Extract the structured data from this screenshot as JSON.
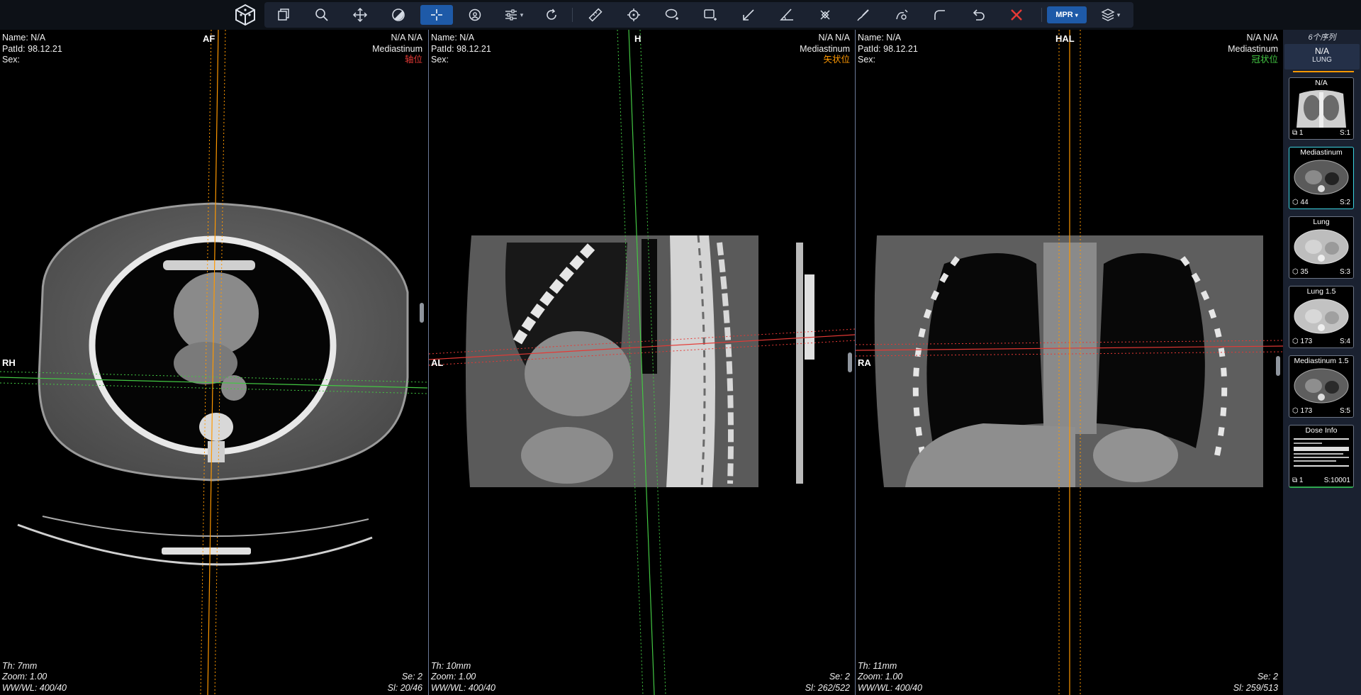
{
  "colors": {
    "toolbar_bg": "#0d1117",
    "accent": "#1e5aa8",
    "crosshair_red": "#e53935",
    "crosshair_orange": "#ff9800",
    "crosshair_green": "#43c743"
  },
  "toolbar": {
    "tools": [
      {
        "icon": "copy-layers-icon"
      },
      {
        "icon": "zoom-magnifier-icon"
      },
      {
        "icon": "pan-move-icon"
      },
      {
        "icon": "window-level-contrast-icon"
      },
      {
        "icon": "crosshair-icon",
        "active": true
      },
      {
        "icon": "rotate-3d-icon"
      },
      {
        "icon": "sliders-adjust-icon",
        "dropdown": true
      },
      {
        "icon": "refresh-rotate-icon"
      },
      {
        "icon": "ruler-icon"
      },
      {
        "icon": "target-point-icon"
      },
      {
        "icon": "ellipse-roi-icon"
      },
      {
        "icon": "rectangle-roi-icon"
      },
      {
        "icon": "arrow-annotate-icon"
      },
      {
        "icon": "angle-icon"
      },
      {
        "icon": "eraser-icon"
      },
      {
        "icon": "freehand-pen-icon"
      },
      {
        "icon": "spline-pen-icon"
      },
      {
        "icon": "curve-icon"
      },
      {
        "icon": "undo-icon"
      },
      {
        "icon": "clear-x-icon"
      }
    ],
    "mpr_label": "MPR",
    "layers_icon": "layers-icon"
  },
  "viewports": [
    {
      "top_left": [
        "Name: N/A",
        "PatId: 98.12.21",
        "Sex:"
      ],
      "top_right": [
        "N/A N/A",
        "Mediastinum"
      ],
      "plane_label": "轴位",
      "plane_color": "red",
      "top_orient": "AF",
      "left_orient": "RH",
      "bottom_left": [
        "Th: 7mm",
        "Zoom: 1.00",
        "WW/WL: 400/40"
      ],
      "bottom_right": [
        "Se: 2",
        "Sl: 20/46"
      ]
    },
    {
      "top_left": [
        "Name: N/A",
        "PatId: 98.12.21",
        "Sex:"
      ],
      "top_right": [
        "N/A N/A",
        "Mediastinum"
      ],
      "plane_label": "矢状位",
      "plane_color": "orange",
      "top_orient": "H",
      "left_orient": "AL",
      "bottom_left": [
        "Th: 10mm",
        "Zoom: 1.00",
        "WW/WL: 400/40"
      ],
      "bottom_right": [
        "Se: 2",
        "Sl: 262/522"
      ]
    },
    {
      "top_left": [
        "Name: N/A",
        "PatId: 98.12.21",
        "Sex:"
      ],
      "top_right": [
        "N/A N/A",
        "Mediastinum"
      ],
      "plane_label": "冠状位",
      "plane_color": "green",
      "top_orient": "HAL",
      "left_orient": "RA",
      "bottom_left": [
        "Th: 11mm",
        "Zoom: 1.00",
        "WW/WL: 400/40"
      ],
      "bottom_right": [
        "Se: 2",
        "Sl: 259/513"
      ]
    }
  ],
  "series_panel": {
    "count_label": "6个序列",
    "header_name": "N/A",
    "header_sub": "LUNG",
    "thumbnails": [
      {
        "name": "N/A",
        "count": "1",
        "series": "S:1",
        "kind": "scout"
      },
      {
        "name": "Mediastinum",
        "count": "44",
        "series": "S:2",
        "kind": "axial-soft",
        "selected": true
      },
      {
        "name": "Lung",
        "count": "35",
        "series": "S:3",
        "kind": "axial-lung"
      },
      {
        "name": "Lung 1.5",
        "count": "173",
        "series": "S:4",
        "kind": "axial-lung"
      },
      {
        "name": "Mediastinum 1.5",
        "count": "173",
        "series": "S:5",
        "kind": "axial-soft"
      },
      {
        "name": "Dose Info",
        "count": "1",
        "series": "S:10001",
        "kind": "dose"
      }
    ]
  }
}
